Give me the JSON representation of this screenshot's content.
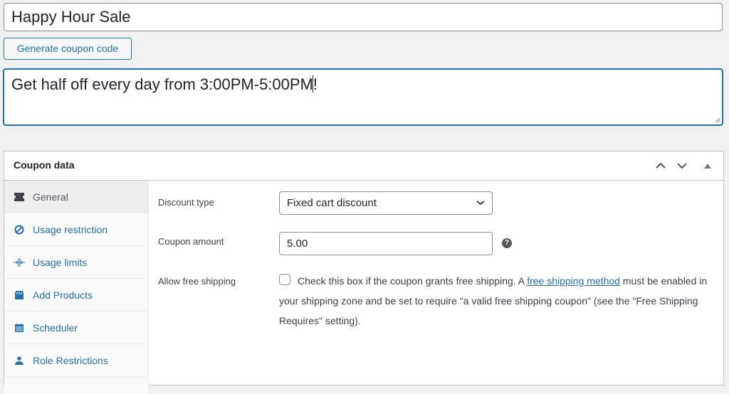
{
  "title_field": {
    "value": "Happy Hour Sale"
  },
  "generate_button": {
    "label": "Generate coupon code"
  },
  "description": {
    "value": "Get half off every day from 3:00PM-5:00PM",
    "value_end": "!"
  },
  "panel": {
    "title": "Coupon data",
    "controls": [
      "move-up",
      "move-down",
      "toggle-panel"
    ]
  },
  "sidebar": {
    "items": [
      {
        "label": "General",
        "icon": "ticket-icon",
        "active": true
      },
      {
        "label": "Usage restriction",
        "icon": "ban-icon"
      },
      {
        "label": "Usage limits",
        "icon": "limits-icon"
      },
      {
        "label": "Add Products",
        "icon": "bag-icon"
      },
      {
        "label": "Scheduler",
        "icon": "calendar-icon"
      },
      {
        "label": "Role Restrictions",
        "icon": "user-icon"
      }
    ]
  },
  "general": {
    "discount_type": {
      "label": "Discount type",
      "value": "Fixed cart discount"
    },
    "coupon_amount": {
      "label": "Coupon amount",
      "value": "5.00",
      "help": "?"
    },
    "free_shipping": {
      "label": "Allow free shipping",
      "checked": false,
      "text_before": "Check this box if the coupon grants free shipping. A ",
      "link": "free shipping method",
      "text_after": " must be enabled in your shipping zone and be set to require \"a valid free shipping coupon\" (see the \"Free Shipping Requires\" setting)."
    }
  },
  "colors": {
    "accent": "#2271b1",
    "border": "#c3c4c7",
    "background": "#f0f0f1"
  }
}
